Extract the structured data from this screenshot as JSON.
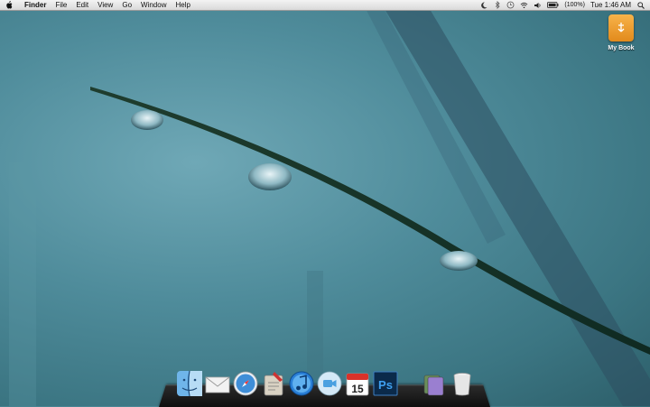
{
  "menubar": {
    "app_name": "Finder",
    "menus": [
      "File",
      "Edit",
      "View",
      "Go",
      "Window",
      "Help"
    ],
    "battery_text": "(100%)",
    "clock": "Tue 1:46 AM"
  },
  "desktop": {
    "drive_label": "My Book"
  },
  "dock": {
    "items": [
      {
        "icon": "finder-icon"
      },
      {
        "icon": "mail-icon"
      },
      {
        "icon": "safari-icon"
      },
      {
        "icon": "script-editor-icon"
      },
      {
        "icon": "itunes-icon"
      },
      {
        "icon": "facetime-icon"
      },
      {
        "icon": "ical-icon",
        "date": "15"
      },
      {
        "icon": "photoshop-icon",
        "label": "Ps"
      },
      {
        "icon": "stack-icon"
      },
      {
        "icon": "trash-icon"
      }
    ]
  },
  "colors": {
    "wallpaper": "#4f8c9b",
    "drive": "#f0a030",
    "dock": "#1a1a1a"
  }
}
